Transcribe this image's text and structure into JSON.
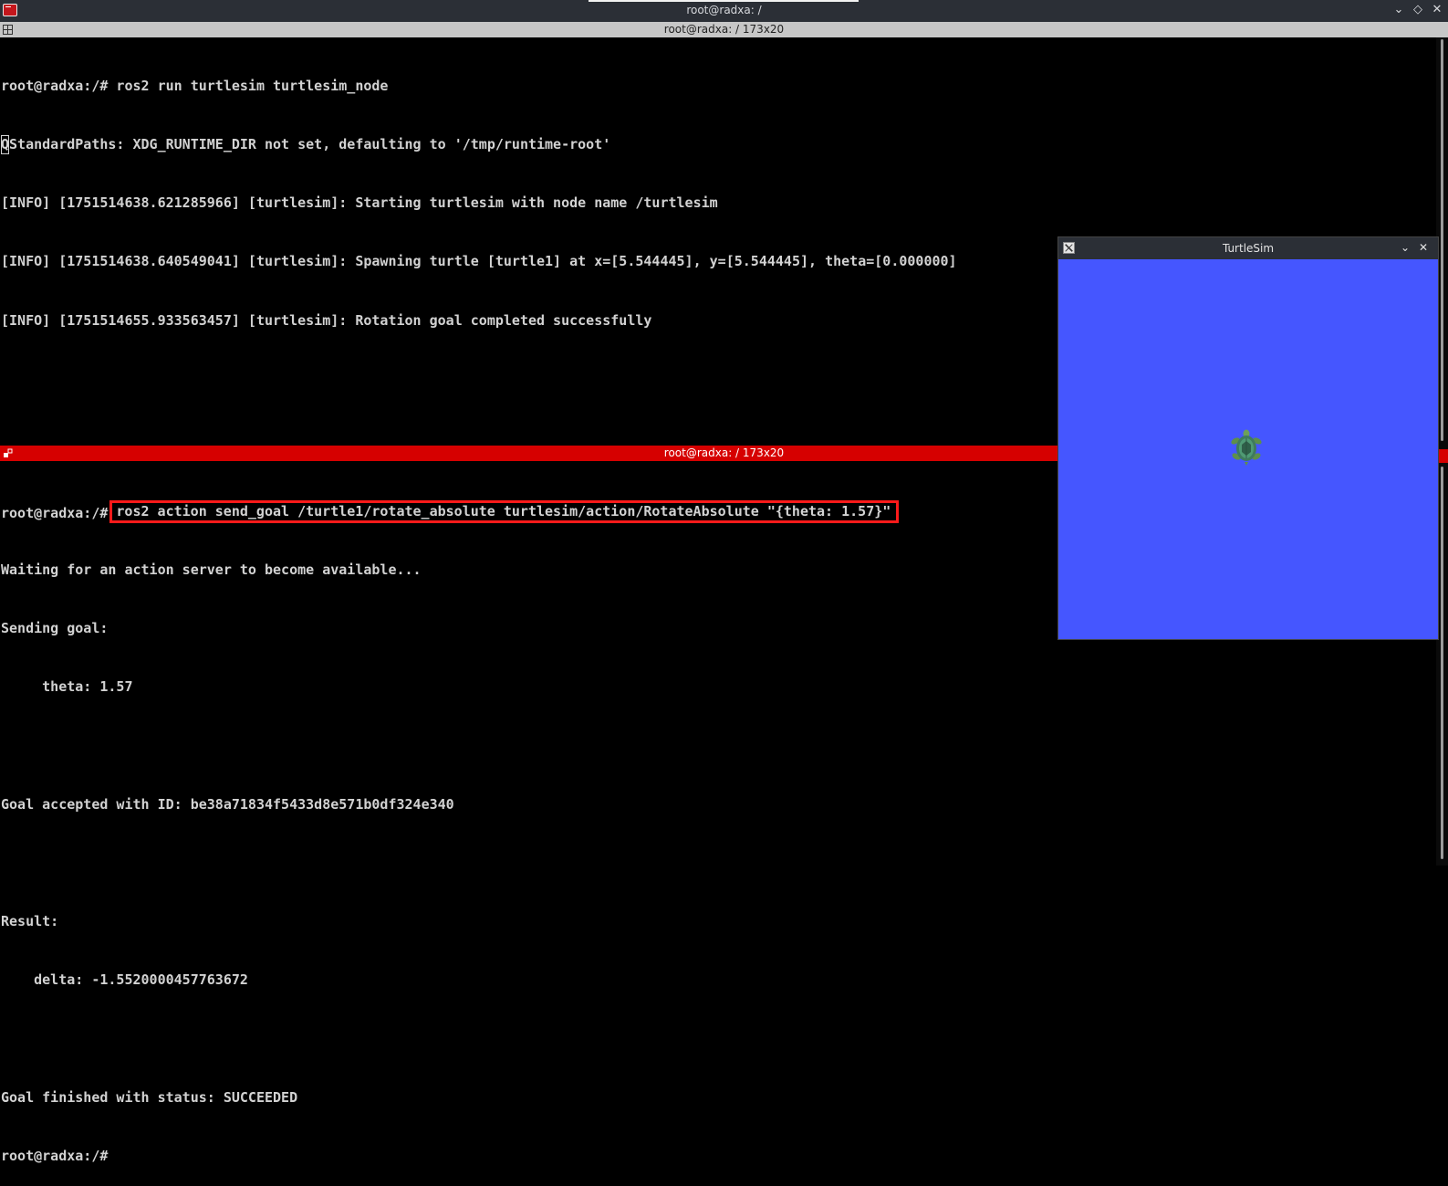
{
  "window": {
    "title": "root@radxa: /",
    "controls": {
      "minimize": "⌄",
      "maximize": "◇",
      "close": "✕"
    }
  },
  "pane_top": {
    "header": "root@radxa: / 173x20",
    "lines": [
      "root@radxa:/# ros2 run turtlesim turtlesim_node",
      "QStandardPaths: XDG_RUNTIME_DIR not set, defaulting to '/tmp/runtime-root'",
      "[INFO] [1751514638.621285966] [turtlesim]: Starting turtlesim with node name /turtlesim",
      "[INFO] [1751514638.640549041] [turtlesim]: Spawning turtle [turtle1] at x=[5.544445], y=[5.544445], theta=[0.000000]",
      "[INFO] [1751514655.933563457] [turtlesim]: Rotation goal completed successfully"
    ]
  },
  "pane_bottom": {
    "header": "root@radxa: / 173x20",
    "prompt": "root@radxa:/#",
    "command": "ros2 action send_goal /turtle1/rotate_absolute turtlesim/action/RotateAbsolute \"{theta: 1.57}\"",
    "lines": [
      "Waiting for an action server to become available...",
      "Sending goal:",
      "     theta: 1.57",
      "",
      "Goal accepted with ID: be38a71834f5433d8e571b0df324e340",
      "",
      "Result:",
      "    delta: -1.5520000457763672",
      "",
      "Goal finished with status: SUCCEEDED",
      "root@radxa:/#"
    ]
  },
  "turtlesim": {
    "title": "TurtleSim",
    "controls": {
      "minimize": "⌄",
      "close": "✕"
    },
    "background_color": "#4556ff",
    "turtle_icon": "turtle-icon"
  },
  "colors": {
    "highlight_box": "#ff1a1a",
    "active_pane_header": "#d60000",
    "inactive_pane_header": "#c7c7c7"
  }
}
